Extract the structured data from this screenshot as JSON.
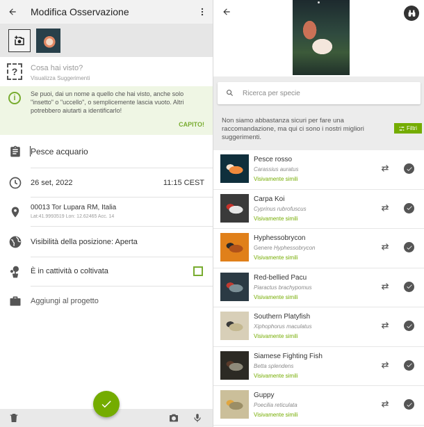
{
  "left": {
    "header": {
      "title": "Modifica Osservazione"
    },
    "what": {
      "placeholder": "Cosa hai visto?",
      "suggestions": "Visualizza Suggerimenti"
    },
    "tip": {
      "text": "Se puoi, dai un nome a quello che hai visto, anche solo \"insetto\" o \"uccello\", o semplicemente lascia vuoto. Altri potrebbero aiutarti a identificarlo!",
      "action": "CAPITO!"
    },
    "species": "Pesce acquario",
    "date": "26 set, 2022",
    "time": "11:15 CEST",
    "location": {
      "address": "00013 Tor Lupara RM, Italia",
      "coords": "Lat:41.9993519 Lon: 12.62465 Acc. 14"
    },
    "visibility": "Visibilità della posizione: Aperta",
    "captive": {
      "label": "È in cattività o coltivata",
      "checked": false
    },
    "project": "Aggiungi al progetto"
  },
  "right": {
    "search": {
      "placeholder": "Ricerca per specie"
    },
    "notice": "Non siamo abbastanza sicuri per fare una raccomandazione, ma qui ci sono i nostri migliori suggerimenti.",
    "filters_label": "Filtri",
    "suggestions": [
      {
        "name": "Pesce rosso",
        "scientific": "Carassius auratus",
        "rank": "",
        "tag": "Visivamente simili",
        "palette": [
          "#0f2f3c",
          "#f08a3c",
          "#f6e3d0"
        ]
      },
      {
        "name": "Carpa Koi",
        "scientific": "Cyprinus rubrofuscus",
        "rank": "",
        "tag": "Visivamente simili",
        "palette": [
          "#3a3a3a",
          "#e5e5e5",
          "#c8312a"
        ]
      },
      {
        "name": "Hyphessobrycon",
        "scientific": "Hyphessobrycon",
        "rank": "Genere",
        "tag": "Visivamente simili",
        "palette": [
          "#e0801a",
          "#b0521a",
          "#2a2a2a"
        ]
      },
      {
        "name": "Red-bellied Pacu",
        "scientific": "Piaractus brachypomus",
        "rank": "",
        "tag": "Visivamente simili",
        "palette": [
          "#2b3a44",
          "#7b8f96",
          "#c03a30"
        ]
      },
      {
        "name": "Southern Platyfish",
        "scientific": "Xiphophorus maculatus",
        "rank": "",
        "tag": "Visivamente simili",
        "palette": [
          "#d8cfb8",
          "#c4b890",
          "#3a3a3a"
        ]
      },
      {
        "name": "Siamese Fighting Fish",
        "scientific": "Betta splendens",
        "rank": "",
        "tag": "Visivamente simili",
        "palette": [
          "#2c2a24",
          "#8e8a7a",
          "#5a3a2a"
        ]
      },
      {
        "name": "Guppy",
        "scientific": "Poecilia reticulata",
        "rank": "",
        "tag": "Visivamente simili",
        "palette": [
          "#cbbf9a",
          "#9b8e66",
          "#e0a640"
        ]
      }
    ]
  }
}
